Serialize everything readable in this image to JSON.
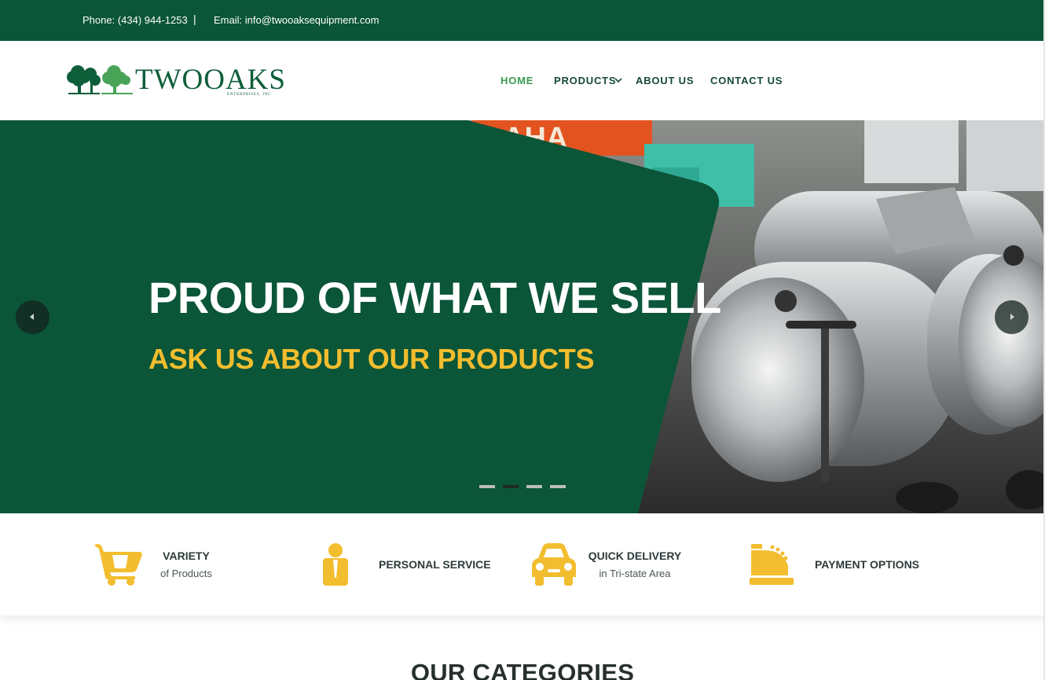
{
  "topbar": {
    "phone": "Phone: (434) 944-1253",
    "separator": "|",
    "email": "Email: info@twooaksequipment.com"
  },
  "header": {
    "logo_text": "TWOOAKS",
    "logo_sub": "ENTERPRISES, INC",
    "nav": [
      {
        "label": "HOME",
        "active": true
      },
      {
        "label": "PRODUCTS",
        "active": false,
        "has_dropdown": true
      },
      {
        "label": "ABOUT US",
        "active": false
      },
      {
        "label": "CONTACT US",
        "active": false
      }
    ]
  },
  "hero": {
    "title": "PROUD OF WHAT WE SELL",
    "subtitle": "ASK US ABOUT OUR PRODUCTS",
    "slide_count": 4,
    "active_slide": 1,
    "prev_icon": "caret-left-icon",
    "next_icon": "caret-right-icon"
  },
  "features": [
    {
      "icon": "shopping-cart-icon",
      "title": "VARIETY",
      "subtitle": "of Products"
    },
    {
      "icon": "person-icon",
      "title": "PERSONAL SERVICE",
      "subtitle": ""
    },
    {
      "icon": "car-icon",
      "title": "QUICK DELIVERY",
      "subtitle": "in Tri-state Area"
    },
    {
      "icon": "cash-register-icon",
      "title": "PAYMENT OPTIONS",
      "subtitle": ""
    }
  ],
  "categories": {
    "title": "OUR CATEGORIES"
  },
  "colors": {
    "brand_green": "#0b5538",
    "accent_yellow": "#f2bd2e",
    "nav_active": "#3a9a52",
    "nav_text": "#16493a"
  }
}
